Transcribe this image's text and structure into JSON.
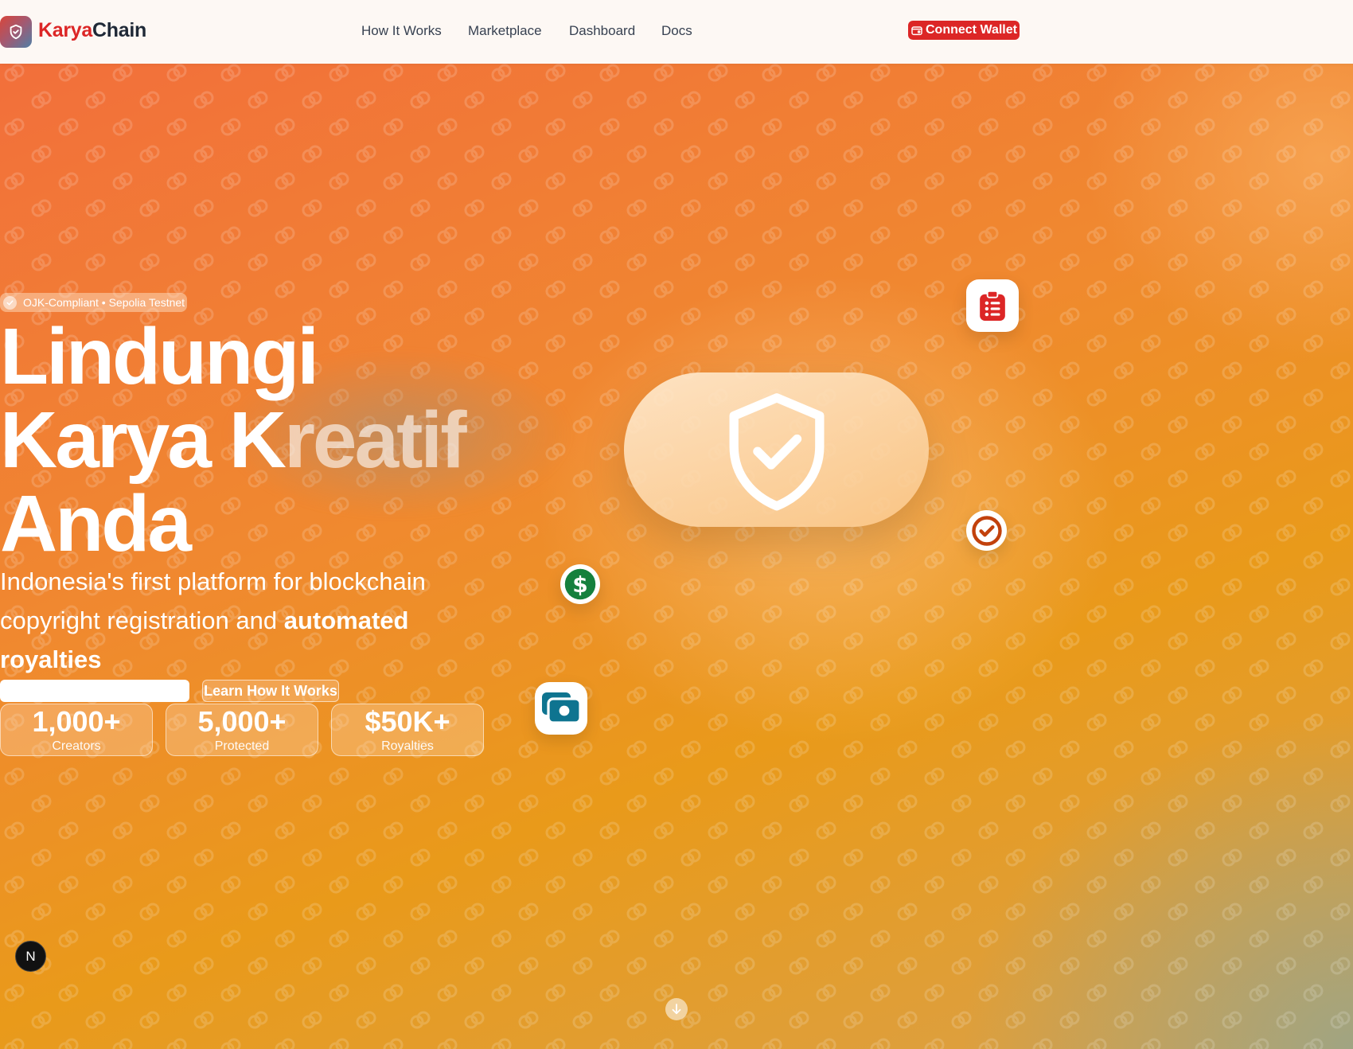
{
  "brand": {
    "name_part1": "Karya",
    "name_part2": "Chain",
    "logo_icon": "shield-icon",
    "accent_color": "#dc2626"
  },
  "nav": {
    "links": [
      {
        "label": "How It Works"
      },
      {
        "label": "Marketplace"
      },
      {
        "label": "Dashboard"
      },
      {
        "label": "Docs"
      }
    ],
    "connect_wallet": {
      "label": "Connect Wallet",
      "icon": "wallet-icon"
    }
  },
  "hero": {
    "badge": "OJK-Compliant • Sepolia Testnet",
    "title_line1": "Lindungi",
    "title_line2a": "Karya K",
    "title_line2b": "reatif",
    "title_line3": "Anda",
    "subtitle_plain": "Indonesia's first platform for blockchain copyright registration and ",
    "subtitle_bold": "automated royalties",
    "primary_button_label": "",
    "secondary_button_label": "Learn How It Works",
    "stats": [
      {
        "value": "1,000+",
        "label": "Creators"
      },
      {
        "value": "5,000+",
        "label": "Protected"
      },
      {
        "value": "$50K+",
        "label": "Royalties"
      }
    ],
    "floating_icons": [
      "clipboard-icon",
      "check-circle-icon",
      "dollar-icon",
      "camera-icon"
    ]
  },
  "misc": {
    "dev_badge": "N"
  }
}
